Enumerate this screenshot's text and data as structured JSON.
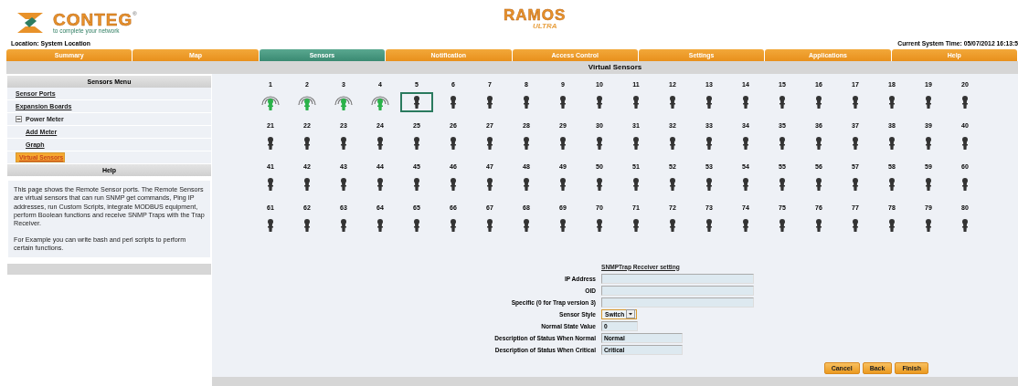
{
  "brand": {
    "name": "CONTEG",
    "registered": "®",
    "tagline": "to complete your network",
    "product": "RAMOS",
    "edition": "ULTRA"
  },
  "location": "Location: System Location",
  "system_time": "Current System Time: 05/07/2012 16:13:5",
  "tabs": [
    {
      "label": "Summary",
      "selected": false
    },
    {
      "label": "Map",
      "selected": false
    },
    {
      "label": "Sensors",
      "selected": true
    },
    {
      "label": "Notification",
      "selected": false
    },
    {
      "label": "Access Control",
      "selected": false
    },
    {
      "label": "Settings",
      "selected": false
    },
    {
      "label": "Applications",
      "selected": false
    },
    {
      "label": "Help",
      "selected": false
    }
  ],
  "page_title": "Virtual Sensors",
  "sidebar": {
    "menu_title": "Sensors Menu",
    "items": [
      {
        "label": "Sensor Ports",
        "kind": "link",
        "selected": false
      },
      {
        "label": "Expansion Boards",
        "kind": "link",
        "selected": false
      },
      {
        "label": "Power Meter",
        "kind": "group",
        "expanded": true,
        "children": [
          {
            "label": "Add Meter",
            "kind": "link",
            "selected": false
          },
          {
            "label": "Graph",
            "kind": "link",
            "selected": false
          }
        ]
      },
      {
        "label": "Virtual Sensors",
        "kind": "link",
        "selected": true
      }
    ],
    "help_title": "Help",
    "help_paragraphs": [
      "This page shows the Remote Sensor ports. The Remote Sensors are virtual sensors that can run SNMP get commands, Ping IP addresses, run Custom Scripts, integrate MODBUS equipment, perform Boolean functions and receive SNMP Traps with the Trap Receiver.",
      "For Example you can write bash and perl scripts to perform certain functions."
    ]
  },
  "sensors": [
    {
      "label": "1",
      "active": true,
      "selected": false
    },
    {
      "label": "2",
      "active": true,
      "selected": false
    },
    {
      "label": "3",
      "active": true,
      "selected": false
    },
    {
      "label": "4",
      "active": true,
      "selected": false
    },
    {
      "label": "5",
      "active": false,
      "selected": true
    },
    {
      "label": "6",
      "active": false,
      "selected": false
    },
    {
      "label": "7",
      "active": false,
      "selected": false
    },
    {
      "label": "8",
      "active": false,
      "selected": false
    },
    {
      "label": "9",
      "active": false,
      "selected": false
    },
    {
      "label": "10",
      "active": false,
      "selected": false
    },
    {
      "label": "11",
      "active": false,
      "selected": false
    },
    {
      "label": "12",
      "active": false,
      "selected": false
    },
    {
      "label": "13",
      "active": false,
      "selected": false
    },
    {
      "label": "14",
      "active": false,
      "selected": false
    },
    {
      "label": "15",
      "active": false,
      "selected": false
    },
    {
      "label": "16",
      "active": false,
      "selected": false
    },
    {
      "label": "17",
      "active": false,
      "selected": false
    },
    {
      "label": "18",
      "active": false,
      "selected": false
    },
    {
      "label": "19",
      "active": false,
      "selected": false
    },
    {
      "label": "20",
      "active": false,
      "selected": false
    },
    {
      "label": "21",
      "active": false,
      "selected": false
    },
    {
      "label": "22",
      "active": false,
      "selected": false
    },
    {
      "label": "23",
      "active": false,
      "selected": false
    },
    {
      "label": "24",
      "active": false,
      "selected": false
    },
    {
      "label": "25",
      "active": false,
      "selected": false
    },
    {
      "label": "26",
      "active": false,
      "selected": false
    },
    {
      "label": "27",
      "active": false,
      "selected": false
    },
    {
      "label": "28",
      "active": false,
      "selected": false
    },
    {
      "label": "29",
      "active": false,
      "selected": false
    },
    {
      "label": "30",
      "active": false,
      "selected": false
    },
    {
      "label": "31",
      "active": false,
      "selected": false
    },
    {
      "label": "32",
      "active": false,
      "selected": false
    },
    {
      "label": "33",
      "active": false,
      "selected": false
    },
    {
      "label": "34",
      "active": false,
      "selected": false
    },
    {
      "label": "35",
      "active": false,
      "selected": false
    },
    {
      "label": "36",
      "active": false,
      "selected": false
    },
    {
      "label": "37",
      "active": false,
      "selected": false
    },
    {
      "label": "38",
      "active": false,
      "selected": false
    },
    {
      "label": "39",
      "active": false,
      "selected": false
    },
    {
      "label": "40",
      "active": false,
      "selected": false
    },
    {
      "label": "41",
      "active": false,
      "selected": false
    },
    {
      "label": "42",
      "active": false,
      "selected": false
    },
    {
      "label": "43",
      "active": false,
      "selected": false
    },
    {
      "label": "44",
      "active": false,
      "selected": false
    },
    {
      "label": "45",
      "active": false,
      "selected": false
    },
    {
      "label": "46",
      "active": false,
      "selected": false
    },
    {
      "label": "47",
      "active": false,
      "selected": false
    },
    {
      "label": "48",
      "active": false,
      "selected": false
    },
    {
      "label": "49",
      "active": false,
      "selected": false
    },
    {
      "label": "50",
      "active": false,
      "selected": false
    },
    {
      "label": "51",
      "active": false,
      "selected": false
    },
    {
      "label": "52",
      "active": false,
      "selected": false
    },
    {
      "label": "53",
      "active": false,
      "selected": false
    },
    {
      "label": "54",
      "active": false,
      "selected": false
    },
    {
      "label": "55",
      "active": false,
      "selected": false
    },
    {
      "label": "56",
      "active": false,
      "selected": false
    },
    {
      "label": "57",
      "active": false,
      "selected": false
    },
    {
      "label": "58",
      "active": false,
      "selected": false
    },
    {
      "label": "59",
      "active": false,
      "selected": false
    },
    {
      "label": "60",
      "active": false,
      "selected": false
    },
    {
      "label": "61",
      "active": false,
      "selected": false
    },
    {
      "label": "62",
      "active": false,
      "selected": false
    },
    {
      "label": "63",
      "active": false,
      "selected": false
    },
    {
      "label": "64",
      "active": false,
      "selected": false
    },
    {
      "label": "65",
      "active": false,
      "selected": false
    },
    {
      "label": "66",
      "active": false,
      "selected": false
    },
    {
      "label": "67",
      "active": false,
      "selected": false
    },
    {
      "label": "68",
      "active": false,
      "selected": false
    },
    {
      "label": "69",
      "active": false,
      "selected": false
    },
    {
      "label": "70",
      "active": false,
      "selected": false
    },
    {
      "label": "71",
      "active": false,
      "selected": false
    },
    {
      "label": "72",
      "active": false,
      "selected": false
    },
    {
      "label": "73",
      "active": false,
      "selected": false
    },
    {
      "label": "74",
      "active": false,
      "selected": false
    },
    {
      "label": "75",
      "active": false,
      "selected": false
    },
    {
      "label": "76",
      "active": false,
      "selected": false
    },
    {
      "label": "77",
      "active": false,
      "selected": false
    },
    {
      "label": "78",
      "active": false,
      "selected": false
    },
    {
      "label": "79",
      "active": false,
      "selected": false
    },
    {
      "label": "80",
      "active": false,
      "selected": false
    }
  ],
  "trap_form": {
    "title": "SNMPTrap Receiver setting",
    "fields": [
      {
        "label": "IP Address",
        "kind": "text"
      },
      {
        "label": "OID",
        "kind": "text"
      },
      {
        "label": "Specific (0 for Trap version 3)",
        "kind": "text"
      },
      {
        "label": "Sensor Style",
        "kind": "select",
        "value": "Switch"
      },
      {
        "label": "Normal State Value",
        "kind": "text",
        "value": "0"
      },
      {
        "label": "Description of Status When Normal",
        "kind": "text",
        "value": "Normal"
      },
      {
        "label": "Description of Status When Critical",
        "kind": "text",
        "value": "Critical"
      }
    ]
  },
  "buttons": [
    "Cancel",
    "Back",
    "Finish"
  ]
}
